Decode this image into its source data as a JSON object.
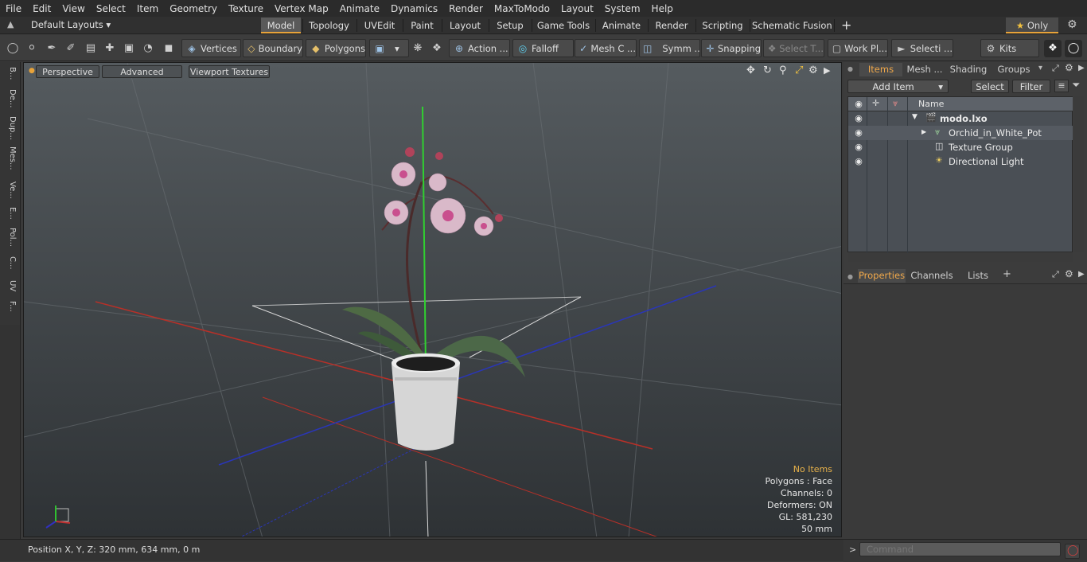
{
  "menu": [
    "File",
    "Edit",
    "View",
    "Select",
    "Item",
    "Geometry",
    "Texture",
    "Vertex Map",
    "Animate",
    "Dynamics",
    "Render",
    "MaxToModo",
    "Layout",
    "System",
    "Help"
  ],
  "layouts": {
    "selector": "Default Layouts",
    "tabs": [
      "Model",
      "Topology",
      "UVEdit",
      "Paint",
      "Layout",
      "Setup",
      "Game Tools",
      "Animate",
      "Render",
      "Scripting",
      "Schematic Fusion"
    ],
    "active_tab": "Model",
    "add": "+",
    "only_label": "Only"
  },
  "toolbar": {
    "vertices": "Vertices",
    "boundary": "Boundary",
    "polygons": "Polygons",
    "action": "Action ...",
    "falloff": "Falloff",
    "mesh_c": "Mesh C ...",
    "symm": "Symm ...",
    "snapping": "Snapping",
    "select_t": "Select T...",
    "work_pl": "Work Pl...",
    "selecti": "Selecti ...",
    "kits": "Kits"
  },
  "left_tabs": [
    "B...",
    "De...",
    "Dup...",
    "Mes...",
    "Ve...",
    "E...",
    "Pol...",
    "C...",
    "UV",
    "F..."
  ],
  "viewport": {
    "perspective": "Perspective",
    "advanced": "Advanced",
    "textures": "Viewport Textures",
    "info": {
      "no_items": "No Items",
      "polygons": "Polygons : Face",
      "channels": "Channels: 0",
      "deformers": "Deformers: ON",
      "gl": "GL: 581,230",
      "focal": "50 mm"
    }
  },
  "status": {
    "position": "Position X, Y, Z:  320 mm, 634 mm, 0 m"
  },
  "items_panel": {
    "tabs": [
      "Items",
      "Mesh ...",
      "Shading",
      "Groups"
    ],
    "active_tab": "Items",
    "add_item": "Add Item",
    "select": "Select",
    "filter": "Filter",
    "col_name": "Name",
    "rows": [
      {
        "name": "modo.lxo",
        "indent": 0
      },
      {
        "name": "Orchid_in_White_Pot",
        "indent": 1
      },
      {
        "name": "Texture Group",
        "indent": 1
      },
      {
        "name": "Directional Light",
        "indent": 1
      }
    ]
  },
  "properties_panel": {
    "tabs": [
      "Properties",
      "Channels",
      "Lists"
    ],
    "active_tab": "Properties",
    "add": "+"
  },
  "command": {
    "prompt": ">",
    "placeholder": "Command"
  },
  "colors": {
    "accent": "#e8a33a",
    "x_axis": "#c0302a",
    "y_axis": "#30c030",
    "z_axis": "#2a3ac0"
  }
}
